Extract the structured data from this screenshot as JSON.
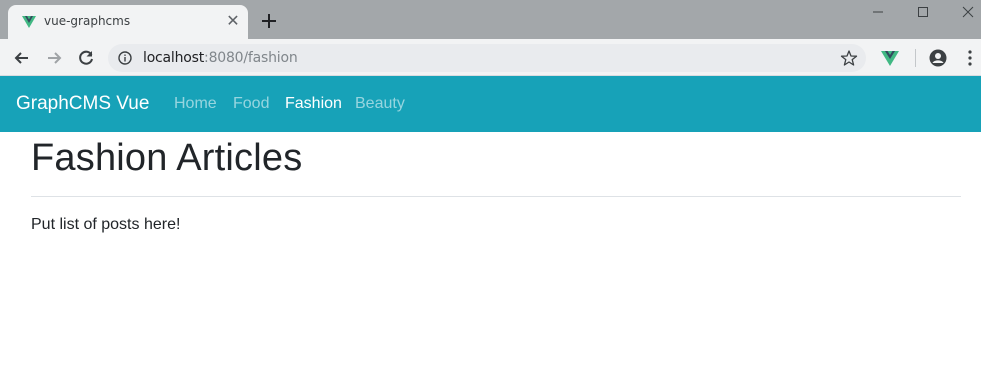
{
  "browser": {
    "tab_title": "vue-graphcms",
    "url_host": "localhost",
    "url_path": ":8080/fashion"
  },
  "navbar": {
    "brand": "GraphCMS Vue",
    "links": [
      {
        "label": "Home",
        "active": false
      },
      {
        "label": "Food",
        "active": false
      },
      {
        "label": "Fashion",
        "active": true
      },
      {
        "label": "Beauty",
        "active": false
      }
    ]
  },
  "main": {
    "title": "Fashion Articles",
    "body": "Put list of posts here!"
  },
  "colors": {
    "navbar_bg": "#17a2b8",
    "vue_green": "#41b883",
    "vue_dark": "#34495e"
  }
}
